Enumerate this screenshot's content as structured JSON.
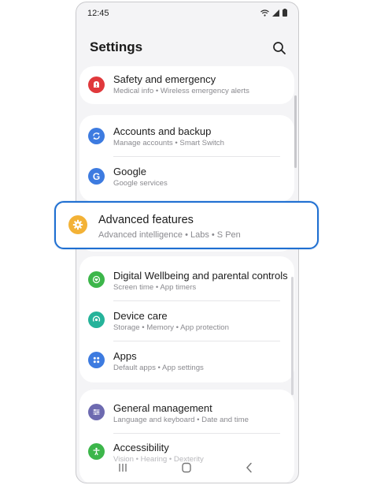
{
  "status_bar": {
    "time": "12:45"
  },
  "header": {
    "title": "Settings"
  },
  "items": [
    {
      "title": "Safety and emergency",
      "subtitle": "Medical info  •  Wireless emergency alerts",
      "icon": "alert-icon",
      "color": "#e0393c"
    },
    {
      "title": "Accounts and backup",
      "subtitle": "Manage accounts  •  Smart Switch",
      "icon": "sync-icon",
      "color": "#3d7be0"
    },
    {
      "title": "Google",
      "subtitle": "Google services",
      "icon": "google-icon",
      "color": "#3d7be0"
    },
    {
      "title": "Digital Wellbeing and parental controls",
      "subtitle": "Screen time  •  App timers",
      "icon": "wellbeing-icon",
      "color": "#3cb64a"
    },
    {
      "title": "Device care",
      "subtitle": "Storage  •  Memory  •  App protection",
      "icon": "device-care-icon",
      "color": "#25b39a"
    },
    {
      "title": "Apps",
      "subtitle": "Default apps  •  App settings",
      "icon": "apps-icon",
      "color": "#3d7be0"
    },
    {
      "title": "General management",
      "subtitle": "Language and keyboard  •  Date and time",
      "icon": "sliders-icon",
      "color": "#6d6ab0"
    },
    {
      "title": "Accessibility",
      "subtitle": "Vision  •  Hearing  •  Dexterity",
      "icon": "accessibility-icon",
      "color": "#3cb64a"
    }
  ],
  "highlight": {
    "title": "Advanced features",
    "subtitle": "Advanced intelligence  •  Labs  •  S Pen",
    "icon": "gear-icon",
    "color": "#f3b236",
    "border_color": "#1f6fd1"
  },
  "nav_bar": {
    "buttons": [
      "recents-button",
      "home-button",
      "back-button"
    ]
  }
}
